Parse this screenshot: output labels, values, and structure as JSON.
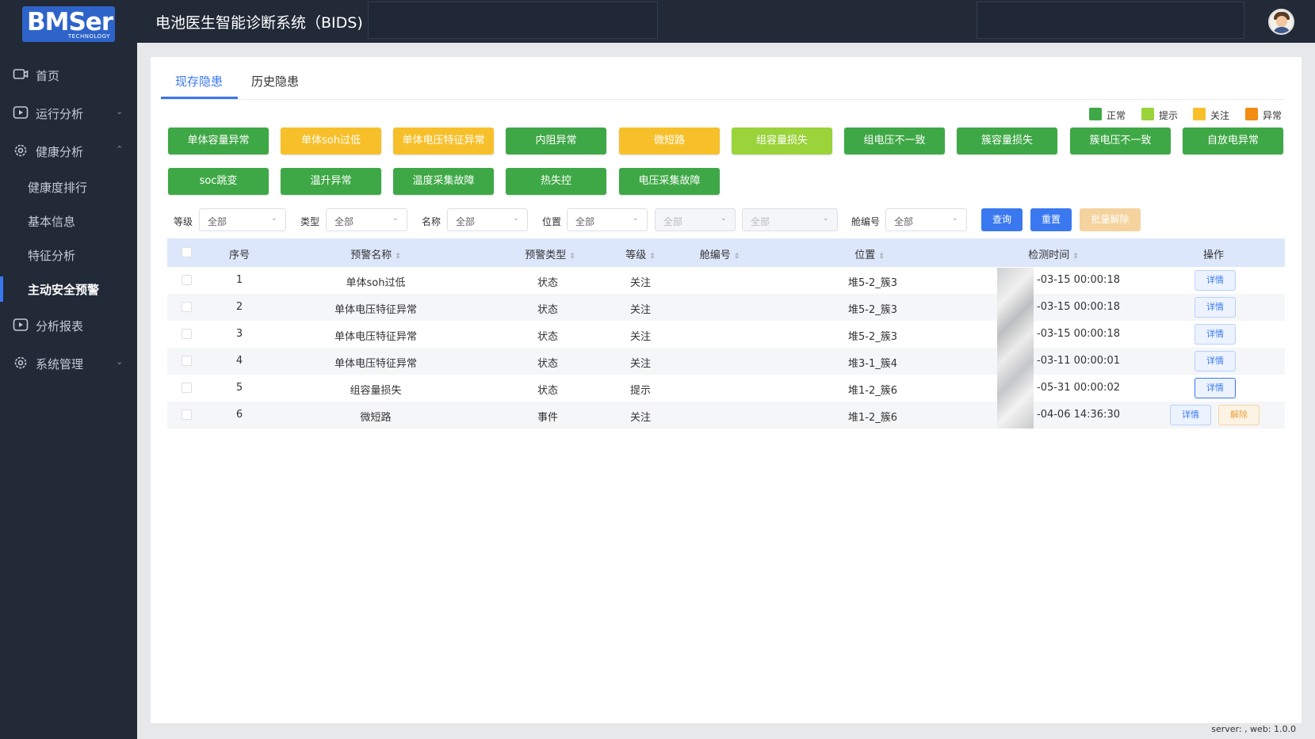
{
  "header": {
    "logo_text": "BMSer",
    "logo_sub": "TECHNOLOGY",
    "title": "电池医生智能诊断系统（BIDS)"
  },
  "sidebar": {
    "items": [
      {
        "label": "首页",
        "icon": "monitor-icon"
      },
      {
        "label": "运行分析",
        "icon": "play-icon"
      },
      {
        "label": "健康分析",
        "icon": "gear-icon"
      },
      {
        "label": "健康度排行"
      },
      {
        "label": "基本信息"
      },
      {
        "label": "特征分析"
      },
      {
        "label": "主动安全预警"
      },
      {
        "label": "分析报表",
        "icon": "play-icon"
      },
      {
        "label": "系统管理",
        "icon": "gear-icon"
      }
    ]
  },
  "tabs": [
    "现存隐患",
    "历史隐患"
  ],
  "legend": [
    {
      "label": "正常",
      "color": "#3fa846"
    },
    {
      "label": "提示",
      "color": "#9ad33a"
    },
    {
      "label": "关注",
      "color": "#f7c02b"
    },
    {
      "label": "异常",
      "color": "#f28c13"
    }
  ],
  "tags": [
    {
      "label": "单体容量异常",
      "color": "#3fa846"
    },
    {
      "label": "单体soh过低",
      "color": "#f7c02b"
    },
    {
      "label": "单体电压特征异常",
      "color": "#f7c02b"
    },
    {
      "label": "内阻异常",
      "color": "#3fa846"
    },
    {
      "label": "微短路",
      "color": "#f7c02b"
    },
    {
      "label": "组容量损失",
      "color": "#9ad33a"
    },
    {
      "label": "组电压不一致",
      "color": "#3fa846"
    },
    {
      "label": "簇容量损失",
      "color": "#3fa846"
    },
    {
      "label": "簇电压不一致",
      "color": "#3fa846"
    },
    {
      "label": "自放电异常",
      "color": "#3fa846"
    },
    {
      "label": "soc跳变",
      "color": "#3fa846"
    },
    {
      "label": "温升异常",
      "color": "#3fa846"
    },
    {
      "label": "温度采集故障",
      "color": "#3fa846"
    },
    {
      "label": "热失控",
      "color": "#3fa846"
    },
    {
      "label": "电压采集故障",
      "color": "#3fa846"
    }
  ],
  "filters": {
    "level_label": "等级",
    "type_label": "类型",
    "name_label": "名称",
    "position_label": "位置",
    "cabin_label": "舱编号",
    "all": "全部",
    "query": "查询",
    "reset": "重置",
    "batch_release": "批量解除"
  },
  "table": {
    "headers": [
      "序号",
      "预警名称",
      "预警类型",
      "等级",
      "舱编号",
      "位置",
      "检测时间",
      "操作"
    ],
    "detail": "详情",
    "release": "解除",
    "rows": [
      {
        "no": "1",
        "name": "单体soh过低",
        "type": "状态",
        "level": "关注",
        "cabin": "",
        "pos": "堆5-2_簇3",
        "time": "-03-15 00:00:18"
      },
      {
        "no": "2",
        "name": "单体电压特征异常",
        "type": "状态",
        "level": "关注",
        "cabin": "",
        "pos": "堆5-2_簇3",
        "time": "-03-15 00:00:18"
      },
      {
        "no": "3",
        "name": "单体电压特征异常",
        "type": "状态",
        "level": "关注",
        "cabin": "",
        "pos": "堆5-2_簇3",
        "time": "-03-15 00:00:18"
      },
      {
        "no": "4",
        "name": "单体电压特征异常",
        "type": "状态",
        "level": "关注",
        "cabin": "",
        "pos": "堆3-1_簇4",
        "time": "-03-11 00:00:01"
      },
      {
        "no": "5",
        "name": "组容量损失",
        "type": "状态",
        "level": "提示",
        "cabin": "",
        "pos": "堆1-2_簇6",
        "time": "-05-31 00:00:02"
      },
      {
        "no": "6",
        "name": "微短路",
        "type": "事件",
        "level": "关注",
        "cabin": "",
        "pos": "堆1-2_簇6",
        "time": "-04-06 14:36:30"
      }
    ]
  },
  "footer": "server: , web: 1.0.0"
}
